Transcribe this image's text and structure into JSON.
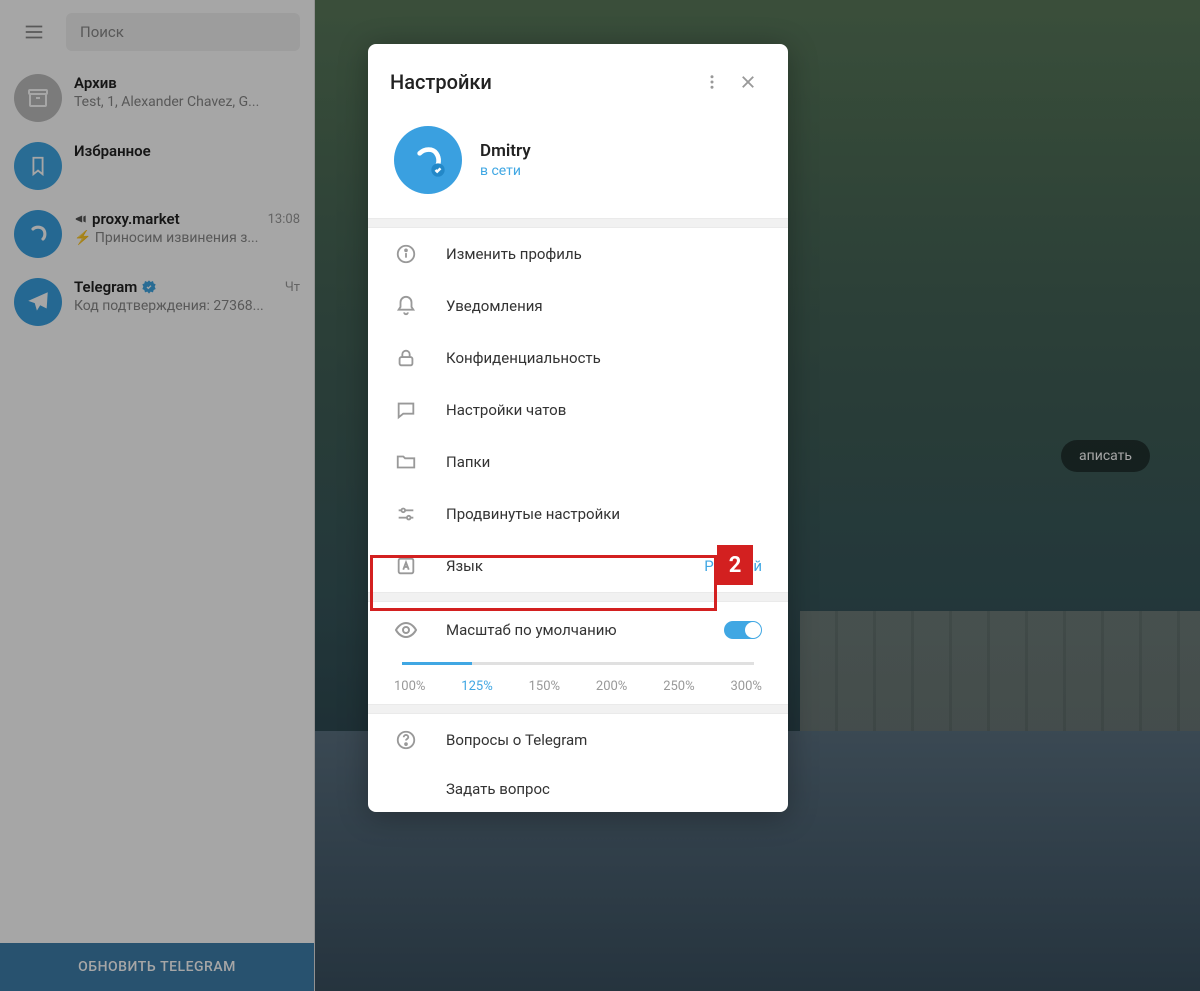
{
  "sidebar": {
    "search_placeholder": "Поиск",
    "chats": [
      {
        "name": "Архив",
        "preview": "Test, 1, Alexander Chavez, G...",
        "time": ""
      },
      {
        "name": "Избранное",
        "preview": "",
        "time": ""
      },
      {
        "name": "proxy.market",
        "preview": "⚡ Приносим извинения з...",
        "time": "13:08",
        "channel": true
      },
      {
        "name": "Telegram",
        "preview": "Код подтверждения: 27368...",
        "time": "Чт",
        "verified": true
      }
    ],
    "update_label": "ОБНОВИТЬ TELEGRAM"
  },
  "compose_hint": "аписать",
  "modal": {
    "title": "Настройки",
    "profile": {
      "name": "Dmitry",
      "status": "в сети"
    },
    "items": [
      {
        "icon": "info",
        "label": "Изменить профиль"
      },
      {
        "icon": "bell",
        "label": "Уведомления"
      },
      {
        "icon": "lock",
        "label": "Конфиденциальность"
      },
      {
        "icon": "chat",
        "label": "Настройки чатов"
      },
      {
        "icon": "folder",
        "label": "Папки"
      },
      {
        "icon": "sliders",
        "label": "Продвинутые настройки",
        "highlighted": true
      },
      {
        "icon": "lang",
        "label": "Язык",
        "value": "Русский"
      }
    ],
    "scale": {
      "label": "Масштаб по умолчанию",
      "options": [
        "100%",
        "125%",
        "150%",
        "200%",
        "250%",
        "300%"
      ],
      "active_index": 1
    },
    "help": {
      "faq": "Вопросы о Telegram",
      "ask": "Задать вопрос"
    }
  },
  "annotation": {
    "badge": "2"
  }
}
